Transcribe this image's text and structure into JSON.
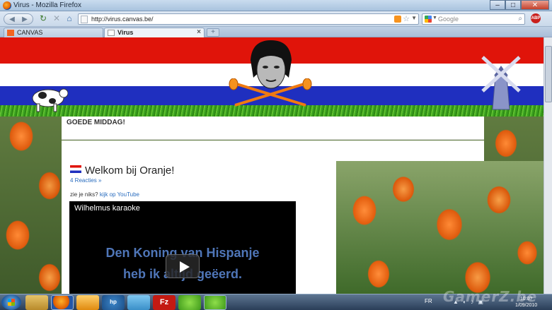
{
  "window": {
    "title": "Virus - Mozilla Firefox"
  },
  "nav": {
    "url": "http://virus.canvas.be/",
    "search_placeholder": "Google"
  },
  "tabs": [
    {
      "label": "CANVAS"
    },
    {
      "label": "Virus"
    }
  ],
  "page": {
    "greeting": "GOEDE MIDDAG!",
    "post_title": "Welkom bij Oranje!",
    "comments_link": "4 Reacties »",
    "intro_text": "zie je niks?",
    "intro_link": "kijk op YouTube",
    "video": {
      "title": "Wilhelmus karaoke",
      "lyric_line1": "Den Koning van Hispanje",
      "lyric_line2": "heb ik altijd geëerd."
    }
  },
  "taskbar": {
    "hp_label": "hp",
    "filezilla_label": "Fz",
    "language": "FR",
    "clock_time": "10:0?",
    "clock_date": "1/09/2010"
  },
  "watermark": "GamerZ.be",
  "colors": {
    "flag_red": "#e0140a",
    "flag_white": "#ffffff",
    "flag_blue": "#1f2fbf",
    "link": "#2a6dbf"
  }
}
